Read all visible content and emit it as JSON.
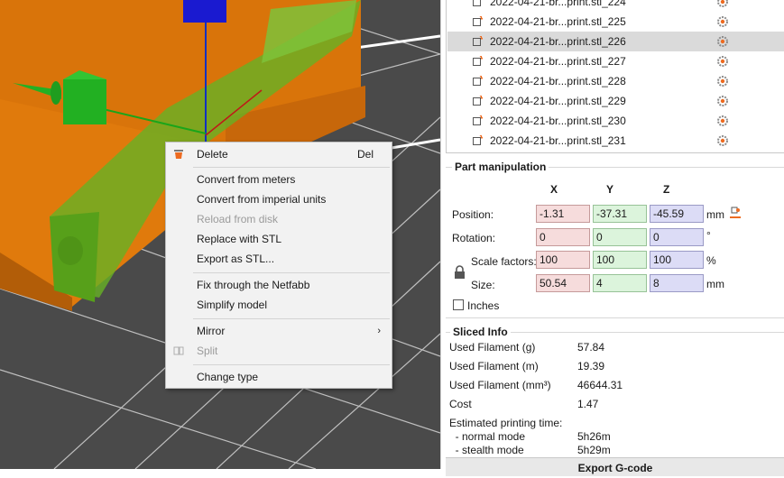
{
  "context_menu": {
    "items": [
      {
        "label": "Delete",
        "shortcut": "Del",
        "disabled": false
      },
      {
        "label": "Convert from meters",
        "disabled": false
      },
      {
        "label": "Convert from imperial units",
        "disabled": false
      },
      {
        "label": "Reload from disk",
        "disabled": true
      },
      {
        "label": "Replace with STL",
        "disabled": false
      },
      {
        "label": "Export as STL...",
        "disabled": false
      },
      {
        "label": "Fix through the Netfabb",
        "disabled": false
      },
      {
        "label": "Simplify model",
        "disabled": false
      },
      {
        "label": "Mirror",
        "submenu": true,
        "disabled": false
      },
      {
        "label": "Split",
        "disabled": true
      },
      {
        "label": "Change type",
        "disabled": false
      }
    ]
  },
  "object_list": {
    "selected_index": 2,
    "items": [
      "2022-04-21-br...print.stl_224",
      "2022-04-21-br...print.stl_225",
      "2022-04-21-br...print.stl_226",
      "2022-04-21-br...print.stl_227",
      "2022-04-21-br...print.stl_228",
      "2022-04-21-br...print.stl_229",
      "2022-04-21-br...print.stl_230",
      "2022-04-21-br...print.stl_231"
    ]
  },
  "part_manipulation": {
    "title": "Part manipulation",
    "axes": [
      "X",
      "Y",
      "Z"
    ],
    "position": {
      "label": "Position:",
      "x": "-1.31",
      "y": "-37.31",
      "z": "-45.59",
      "unit": "mm"
    },
    "rotation": {
      "label": "Rotation:",
      "x": "0",
      "y": "0",
      "z": "0",
      "unit": "°"
    },
    "scale": {
      "label": "Scale factors:",
      "x": "100",
      "y": "100",
      "z": "100",
      "unit": "%"
    },
    "size": {
      "label": "Size:",
      "x": "50.54",
      "y": "4",
      "z": "8",
      "unit": "mm"
    },
    "inches_label": "Inches"
  },
  "sliced_info": {
    "title": "Sliced Info",
    "rows": [
      {
        "k": "Used Filament (g)",
        "v": "57.84"
      },
      {
        "k": "Used Filament (m)",
        "v": "19.39"
      },
      {
        "k": "Used Filament (mm³)",
        "v": "46644.31"
      },
      {
        "k": "Cost",
        "v": "1.47"
      },
      {
        "k": "Estimated printing time:",
        "v": ""
      },
      {
        "k": "  - normal mode",
        "v": "5h26m"
      },
      {
        "k": "  - stealth mode",
        "v": "5h29m"
      }
    ]
  },
  "export_button": "Export G-code",
  "colors": {
    "accent": "#ed6b21",
    "model_orange": "#e2780a",
    "model_green": "#5fae1f",
    "bed": "#4a4a4a"
  }
}
